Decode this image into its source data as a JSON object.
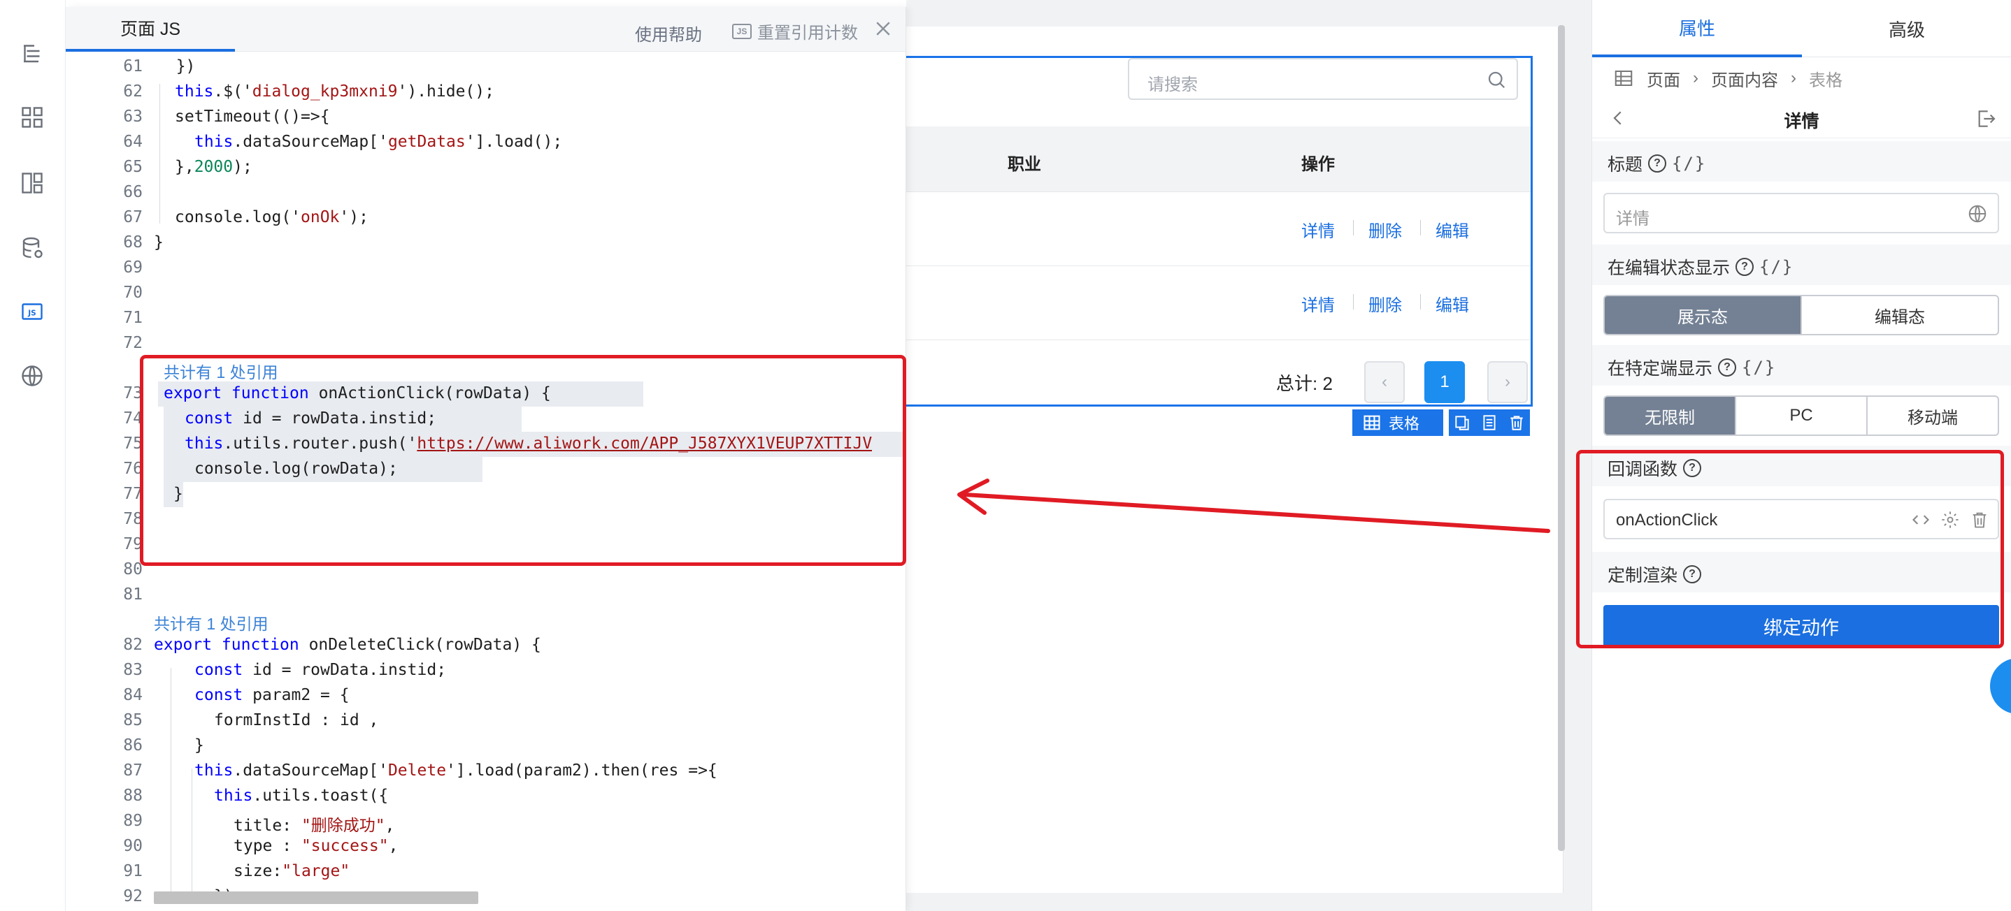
{
  "code_panel": {
    "tab_title": "页面 JS",
    "help": "使用帮助",
    "reset": "重置引用计数",
    "reset_badge": "JS",
    "ref_label": "共计有 1 处引用",
    "lines": {
      "n61": "61",
      "n62": "62",
      "n63": "63",
      "n64": "64",
      "n65": "65",
      "n66": "66",
      "n67": "67",
      "n68": "68",
      "n69": "69",
      "n70": "70",
      "n71": "71",
      "n72": "72",
      "n73": "73",
      "n74": "74",
      "n75": "75",
      "n76": "76",
      "n77": "77",
      "n78": "78",
      "n79": "79",
      "n80": "80",
      "n81": "81",
      "n82": "82",
      "n83": "83",
      "n84": "84",
      "n85": "85",
      "n86": "86",
      "n87": "87",
      "n88": "88",
      "n89": "89",
      "n90": "90",
      "n91": "91",
      "n92": "92"
    },
    "code": {
      "c61": "  })",
      "c62_a": "this",
      "c62_b": ".$('",
      "c62_c": "dialog_kp3mxni9",
      "c62_d": "').hide();",
      "c63": "setTimeout(()=>{",
      "c64_a": "this",
      "c64_b": ".dataSourceMap['",
      "c64_c": "getDatas",
      "c64_d": "'].load();",
      "c65_a": "},",
      "c65_b": "2000",
      "c65_c": ");",
      "c67_a": "console.log('",
      "c67_b": "onOk",
      "c67_c": "');",
      "c68": "}",
      "c73_a": "export function",
      "c73_b": " onActionClick(rowData) {",
      "c74_a": "const",
      "c74_b": " id = rowData.instid;",
      "c75_a": "this",
      "c75_b": ".utils.router.push('",
      "c75_c": "https://www.aliwork.com/APP_J587XYX1VEUP7XTTIJV",
      "c76": "console.log(rowData);",
      "c77": "}",
      "c82_a": "export function",
      "c82_b": " onDeleteClick(rowData) {",
      "c83_a": "const",
      "c83_b": " id = rowData.instid;",
      "c84_a": "const",
      "c84_b": " param2 = {",
      "c85": "formInstId : id ,",
      "c86": "}",
      "c87_a": "this",
      "c87_b": ".dataSourceMap['",
      "c87_c": "Delete",
      "c87_d": "'].load(param2).then(res =>{",
      "c88_a": "this",
      "c88_b": ".utils.toast({",
      "c89_a": "title: ",
      "c89_b": "\"删除成功\"",
      "c89_c": ",",
      "c90_a": "type : ",
      "c90_b": "\"success\"",
      "c90_c": ",",
      "c91_a": "size:",
      "c91_b": "\"large\"",
      "c92": "});"
    }
  },
  "preview": {
    "search_placeholder": "请搜索",
    "col_job": "职业",
    "col_action": "操作",
    "action_detail": "详情",
    "action_delete": "删除",
    "action_edit": "编辑",
    "total": "总计: 2",
    "page_prev": "‹",
    "page_current": "1",
    "page_next": "›",
    "toolbar_label": "表格"
  },
  "settings": {
    "tab_props": "属性",
    "tab_advanced": "高级",
    "crumb_page": "页面",
    "crumb_content": "页面内容",
    "crumb_table": "表格",
    "detail_title": "详情",
    "label_title": "标题",
    "varbind": "{/}",
    "title_placeholder": "详情",
    "label_edit_state": "在编辑状态显示",
    "seg_display": "展示态",
    "seg_edit": "编辑态",
    "label_terminal": "在特定端显示",
    "seg_unlimited": "无限制",
    "seg_pc": "PC",
    "seg_mobile": "移动端",
    "label_callback": "回调函数",
    "callback_value": "onActionClick",
    "label_custom_render": "定制渲染",
    "bind_action": "绑定动作"
  },
  "colors": {
    "accent": "#1b6fe0",
    "annotation_red": "#e01b24",
    "segment_active": "#748194"
  }
}
